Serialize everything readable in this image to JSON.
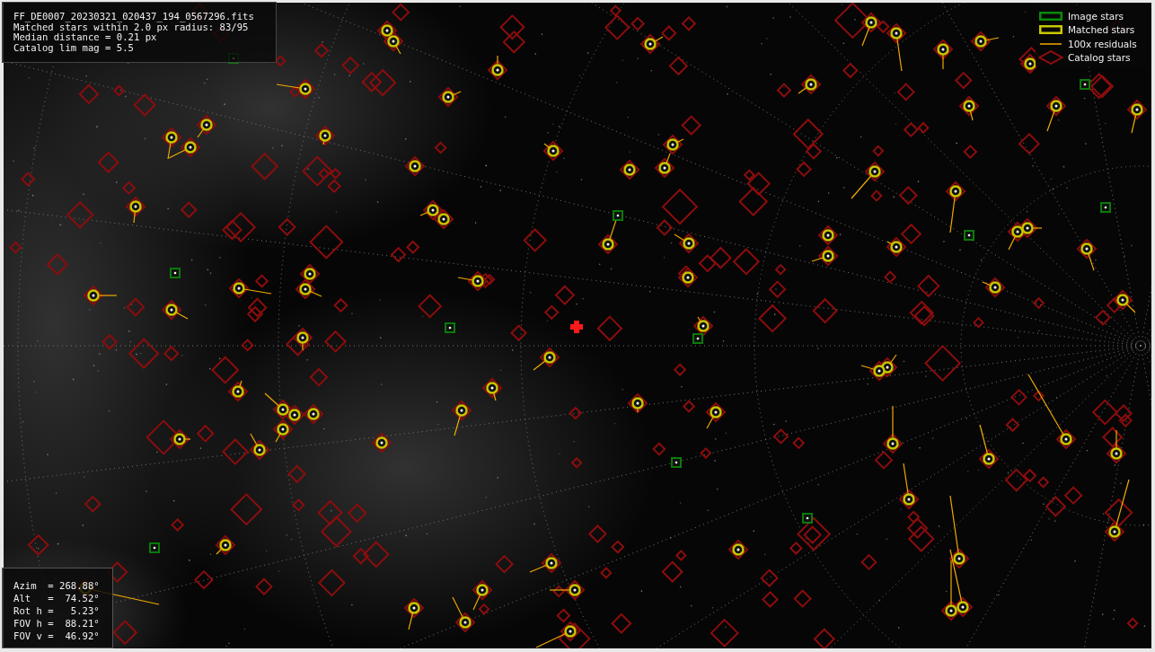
{
  "info_panel": {
    "lines": [
      "FF_DE0007_20230321_020437_194_0567296.fits",
      "Matched stars within 2.0 px radius: 83/95",
      "Median distance = 0.21 px",
      "Catalog lim mag = 5.5"
    ]
  },
  "legend": [
    {
      "kind": "image",
      "label": "Image stars"
    },
    {
      "kind": "matched",
      "label": "Matched stars"
    },
    {
      "kind": "residual",
      "label": "100x residuals"
    },
    {
      "kind": "catalog",
      "label": "Catalog stars"
    }
  ],
  "pointing_panel": {
    "lines": [
      "Azim  = 268.88°",
      "Alt   =  74.52°",
      "Rot h =   5.23°",
      "FOV h =  88.21°",
      "FOV v =  46.92°"
    ]
  }
}
